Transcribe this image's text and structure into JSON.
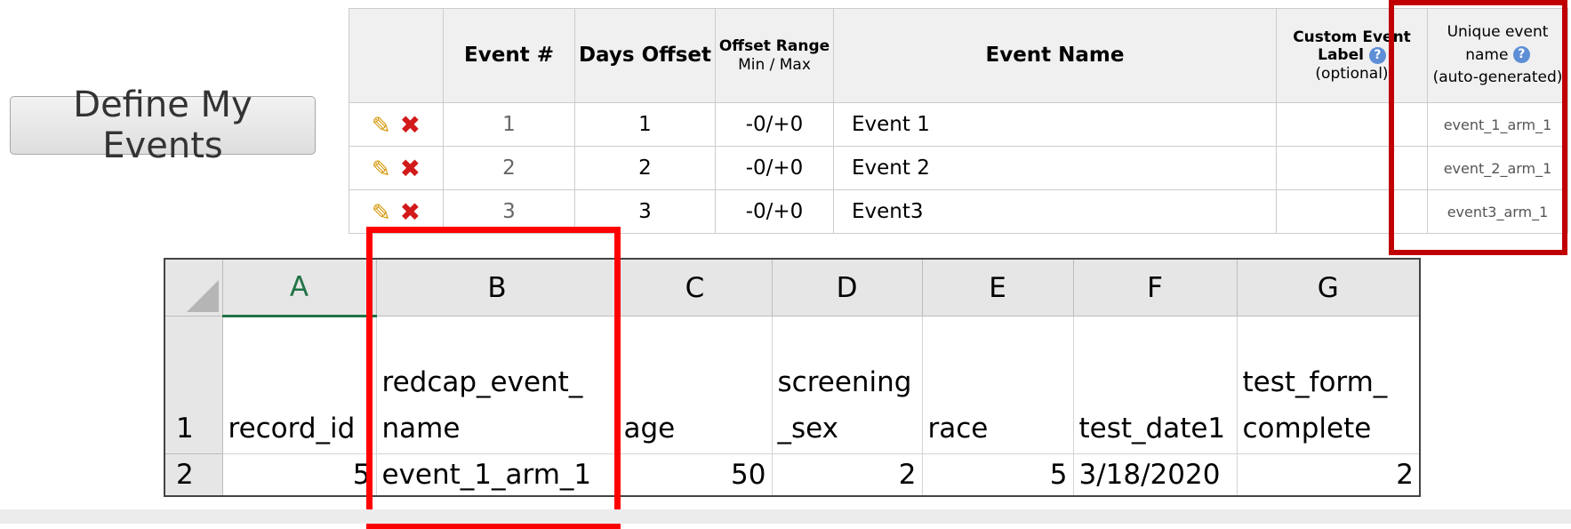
{
  "define_button": {
    "label": "Define My Events"
  },
  "events_table": {
    "headers": {
      "actions": "",
      "event_num": "Event #",
      "days_offset": "Days Offset",
      "offset_range_title": "Offset Range",
      "offset_range_sub": "Min / Max",
      "event_name": "Event Name",
      "custom_label_title": "Custom Event Label",
      "custom_label_sub": "(optional)",
      "unique_title": "Unique event name",
      "unique_sub": "(auto-generated)"
    },
    "rows": [
      {
        "num": "1",
        "days": "1",
        "range": "-0/+0",
        "name": "Event 1",
        "custom": "",
        "unique": "event_1_arm_1"
      },
      {
        "num": "2",
        "days": "2",
        "range": "-0/+0",
        "name": "Event 2",
        "custom": "",
        "unique": "event_2_arm_1"
      },
      {
        "num": "3",
        "days": "3",
        "range": "-0/+0",
        "name": "Event3",
        "custom": "",
        "unique": "event3_arm_1"
      }
    ],
    "icons": {
      "edit": "pencil-icon",
      "delete": "delete-x-icon",
      "help": "help-question-icon"
    }
  },
  "spreadsheet": {
    "columns": [
      "A",
      "B",
      "C",
      "D",
      "E",
      "F",
      "G"
    ],
    "row_numbers": [
      "1",
      "2"
    ],
    "header_row": [
      "record_id",
      "redcap_event_ name",
      "age",
      "screening _sex",
      "race",
      "test_date1",
      "test_form_ complete"
    ],
    "data_row": [
      "5",
      "event_1_arm_1",
      "50",
      "2",
      "5",
      "3/18/2020",
      "2"
    ],
    "active_column_color": "#217346"
  },
  "highlight_color": "#ff0000"
}
